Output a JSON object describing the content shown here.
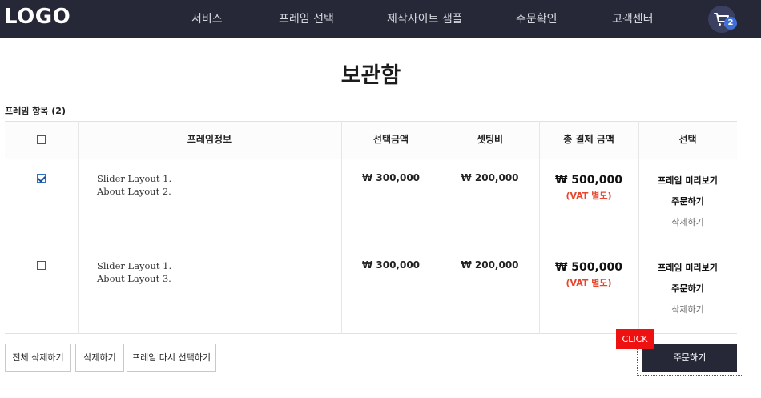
{
  "header": {
    "logo": "LOGO",
    "nav": [
      "서비스",
      "프레임 선택",
      "제작사이트 샘플",
      "주문확인",
      "고객센터"
    ],
    "cart_count": "2"
  },
  "page": {
    "title": "보관함",
    "section_label": "프레임 항목 (2)"
  },
  "table": {
    "headers": [
      "",
      "프레임정보",
      "선택금액",
      "셋팅비",
      "총 결제 금액",
      "선택"
    ],
    "rows": [
      {
        "checked": true,
        "info": [
          "Slider Layout 1.",
          "About Layout 2."
        ],
        "select_price": "₩ 300,000",
        "setting_fee": "₩ 200,000",
        "total": "₩ 500,000",
        "vat_note": "(VAT 별도)",
        "actions": [
          "프레임 미리보기",
          "주문하기",
          "삭제하기"
        ]
      },
      {
        "checked": false,
        "info": [
          "Slider Layout 1.",
          "About Layout 3."
        ],
        "select_price": "₩ 300,000",
        "setting_fee": "₩ 200,000",
        "total": "₩ 500,000",
        "vat_note": "(VAT 별도)",
        "actions": [
          "프레임 미리보기",
          "주문하기",
          "삭제하기"
        ]
      }
    ]
  },
  "buttons": {
    "delete_all": "전체 삭제하기",
    "delete": "삭제하기",
    "reselect": "프레임 다시 선택하기",
    "order": "주문하기",
    "click_tag": "CLICK"
  },
  "colors": {
    "header_bg": "#262838",
    "accent_red": "#e8452c",
    "badge_blue": "#3f6fd8"
  }
}
